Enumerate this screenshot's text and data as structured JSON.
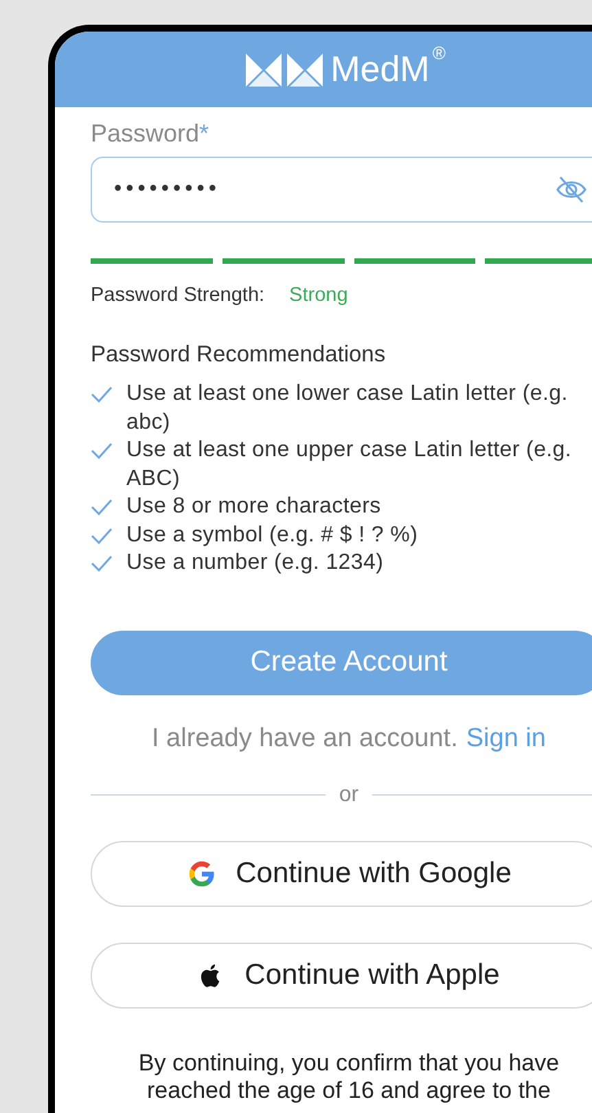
{
  "header": {
    "brand": "MedM",
    "registered_mark": "®"
  },
  "password_field": {
    "label": "Password",
    "required_mark": "*",
    "value": "•••••••••",
    "visible": false
  },
  "strength": {
    "segments": [
      {
        "filled": true
      },
      {
        "filled": true
      },
      {
        "filled": true
      },
      {
        "filled": true
      }
    ],
    "label": "Password Strength:",
    "value": "Strong"
  },
  "recommendations": {
    "title": "Password Recommendations",
    "items": [
      {
        "text": "Use at least one lower case Latin letter (e.g. abc)",
        "met": true
      },
      {
        "text": "Use at least one upper case Latin letter (e.g. ABC)",
        "met": true
      },
      {
        "text": "Use 8 or more characters",
        "met": true
      },
      {
        "text": "Use a symbol (e.g. # $ ! ? %)",
        "met": true
      },
      {
        "text": "Use a number (e.g. 1234)",
        "met": true
      }
    ]
  },
  "create_button": "Create Account",
  "sign_in": {
    "text": "I already have an account.",
    "link": "Sign in"
  },
  "divider": "or",
  "social_buttons": [
    {
      "kind": "google",
      "label": "Continue with Google"
    },
    {
      "kind": "apple",
      "label": "Continue with Apple"
    }
  ],
  "footer_text": "By continuing, you confirm that you have reached the age of 16 and agree to the"
}
